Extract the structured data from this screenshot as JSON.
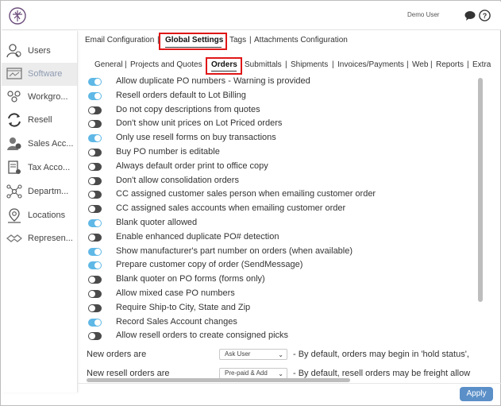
{
  "header": {
    "user_name": "Demo User"
  },
  "sidebar": {
    "items": [
      {
        "label": "Users",
        "icon": "user-icon"
      },
      {
        "label": "Software",
        "icon": "software-icon",
        "active": true
      },
      {
        "label": "Workgro...",
        "icon": "workgroup-icon"
      },
      {
        "label": "Resell",
        "icon": "resell-icon"
      },
      {
        "label": "Sales Acc...",
        "icon": "sales-account-icon"
      },
      {
        "label": "Tax Acco...",
        "icon": "tax-account-icon"
      },
      {
        "label": "Departm...",
        "icon": "department-icon"
      },
      {
        "label": "Locations",
        "icon": "location-icon"
      },
      {
        "label": "Represen...",
        "icon": "representative-icon"
      }
    ]
  },
  "tabs_primary": {
    "email": "Email Configuration",
    "sep1": "|",
    "global": "Global Settings",
    "tags": "Tags",
    "sep2": "|",
    "attachments": "Attachments Configuration"
  },
  "tabs_secondary": {
    "general": "General",
    "s1": "|",
    "projects": "Projects and Quotes",
    "s2": "|",
    "orders": "Orders",
    "submittals": "Submittals",
    "s3": "|",
    "shipments": "Shipments",
    "s4": "|",
    "invoices": "Invoices/Payments",
    "s5": "|",
    "web": "Web",
    "s6": "|",
    "reports": "Reports",
    "s7": "|",
    "extra": "Extra"
  },
  "settings": [
    {
      "label": "Allow duplicate PO numbers - Warning is provided",
      "on": true
    },
    {
      "label": "Resell orders default to Lot Billing",
      "on": true
    },
    {
      "label": "Do not copy descriptions from quotes",
      "on": false
    },
    {
      "label": "Don't show unit prices on Lot Priced orders",
      "on": false
    },
    {
      "label": "Only use resell forms on buy transactions",
      "on": true
    },
    {
      "label": "Buy PO number is editable",
      "on": false
    },
    {
      "label": "Always default order print to office copy",
      "on": false
    },
    {
      "label": "Don't allow consolidation orders",
      "on": false
    },
    {
      "label": "CC assigned customer sales person when emailing customer order",
      "on": false
    },
    {
      "label": "CC assigned sales accounts when emailing customer order",
      "on": false
    },
    {
      "label": "Blank quoter allowed",
      "on": true
    },
    {
      "label": "Enable enhanced duplicate PO# detection",
      "on": false
    },
    {
      "label": "Show manufacturer's part number on orders (when available)",
      "on": true
    },
    {
      "label": "Prepare customer copy of order (SendMessage)",
      "on": true
    },
    {
      "label": "Blank quoter on PO forms (forms only)",
      "on": false
    },
    {
      "label": "Allow mixed case PO numbers",
      "on": false
    },
    {
      "label": "Require Ship-to City, State and Zip",
      "on": false
    },
    {
      "label": "Record Sales Account changes",
      "on": true
    },
    {
      "label": "Allow resell orders to create consigned picks",
      "on": false
    }
  ],
  "dropdown_rows": [
    {
      "label": "New orders are",
      "value": "Ask User",
      "desc": "- By default, orders may begin in 'hold status',"
    },
    {
      "label": "New resell orders are",
      "value": "Pre-paid & Add",
      "desc": "- By default, resell orders may be freight allow"
    }
  ],
  "apply_label": "Apply",
  "colors": {
    "toggle_on": "#5fb8e6",
    "toggle_off": "#4a4a4a",
    "highlight": "#e01616",
    "apply": "#5b8fc8"
  }
}
